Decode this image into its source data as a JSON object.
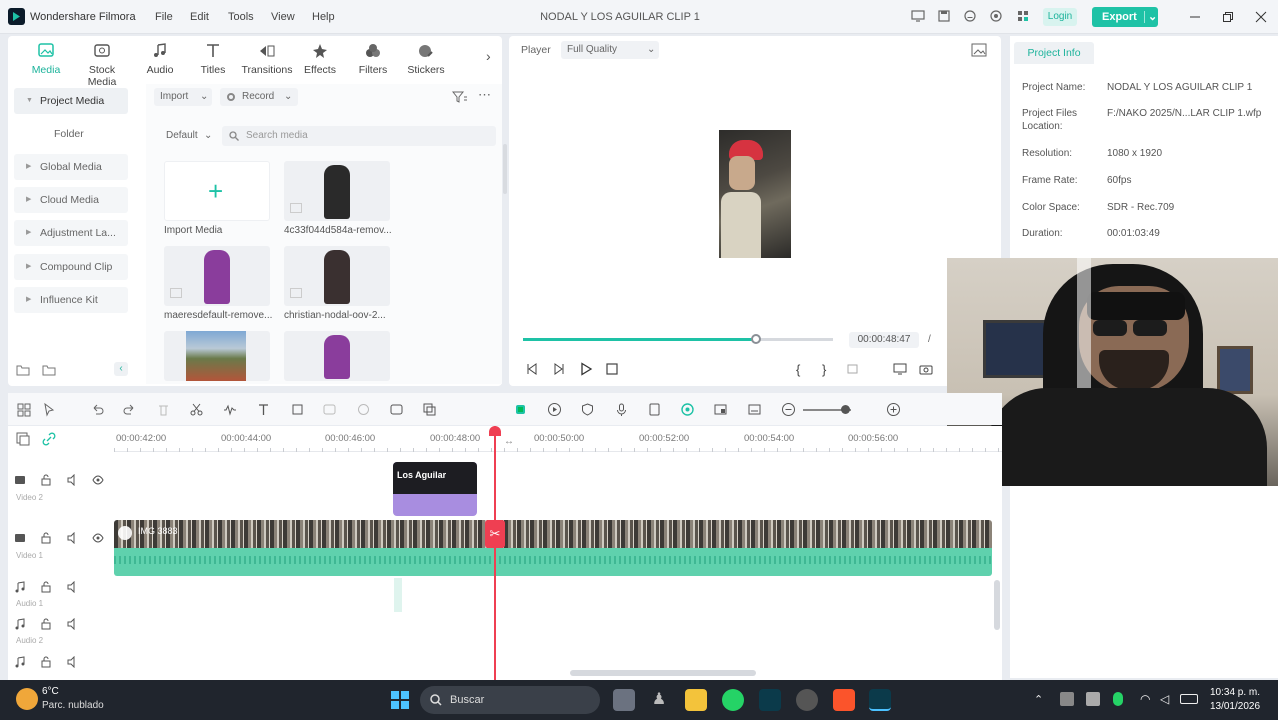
{
  "titlebar": {
    "app_name": "Wondershare Filmora",
    "menus": [
      "File",
      "Edit",
      "Tools",
      "View",
      "Help"
    ],
    "document_title": "NODAL Y LOS AGUILAR CLIP 1",
    "login_label": "Login",
    "export_label": "Export"
  },
  "media_panel": {
    "tabs": [
      "Media",
      "Stock Media",
      "Audio",
      "Titles",
      "Transitions",
      "Effects",
      "Filters",
      "Stickers"
    ],
    "active_tab": "Media",
    "nav": [
      "Project Media",
      "Folder",
      "Global Media",
      "Cloud Media",
      "Adjustment La...",
      "Compound Clip",
      "Influence Kit"
    ],
    "import_label": "Import",
    "record_label": "Record",
    "sort_label": "Default",
    "search_placeholder": "Search media",
    "items": [
      "Import Media",
      "4c33f044d584a-remov...",
      "maeresdefault-remove...",
      "christian-nodal-oov-2..."
    ]
  },
  "player": {
    "label": "Player",
    "quality": "Full Quality",
    "progress": 0.75,
    "timecode": "00:00:48:47",
    "slash": "/"
  },
  "project_info": {
    "tab": "Project Info",
    "rows": [
      {
        "key": "Project Name:",
        "value": "NODAL Y LOS AGUILAR CLIP 1"
      },
      {
        "key": "Project Files Location:",
        "value": "F:/NAKO 2025/N...LAR CLIP 1.wfp"
      },
      {
        "key": "Resolution:",
        "value": "1080 x 1920"
      },
      {
        "key": "Frame Rate:",
        "value": "60fps"
      },
      {
        "key": "Color Space:",
        "value": "SDR - Rec.709"
      },
      {
        "key": "Duration:",
        "value": "00:01:03:49"
      }
    ]
  },
  "timeline": {
    "ruler": [
      "00:00:42:00",
      "00:00:44:00",
      "00:00:46:00",
      "00:00:48:00",
      "00:00:50:00",
      "00:00:52:00",
      "00:00:54:00",
      "00:00:56:00"
    ],
    "tracks": [
      "Video 2",
      "Video 1",
      "Audio 1",
      "Audio 2"
    ],
    "overlay_clip_text": "Los Aguilar",
    "video_clip_label": "IMG 3883"
  },
  "taskbar": {
    "temperature": "6°C",
    "weather": "Parc. nublado",
    "search_label": "Buscar",
    "time": "10:34 p. m.",
    "date": "13/01/2026"
  },
  "colors": {
    "accent": "#1ec2a6",
    "playhead": "#ef3f52",
    "overlay_clip": "#a88de0",
    "audio_wave": "#5fd1ad"
  }
}
